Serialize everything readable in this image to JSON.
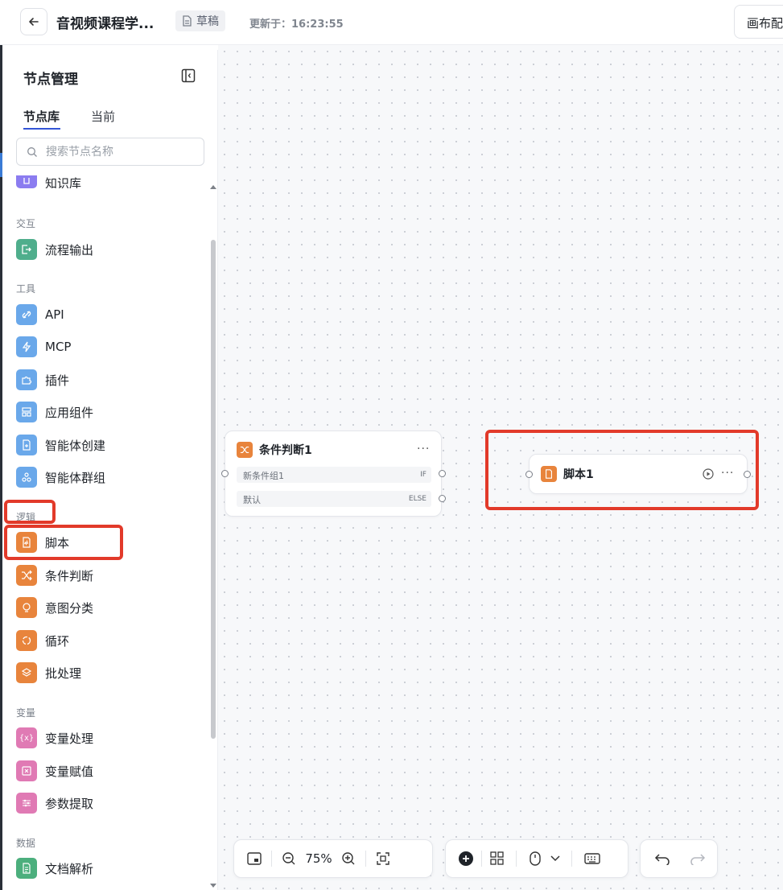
{
  "header": {
    "title": "音视频课程学...",
    "status": "草稿",
    "updated": "更新于：16:23:55",
    "canvas_config_label": "画布配"
  },
  "sidebar": {
    "title": "节点管理",
    "tabs": [
      {
        "label": "节点库"
      },
      {
        "label": "当前"
      }
    ],
    "search_placeholder": "搜索节点名称",
    "partial_item": "知识库",
    "groups": {
      "interaction": "交互",
      "tools": "工具",
      "logic": "逻辑",
      "variables": "变量",
      "data": "数据"
    },
    "items": {
      "flow_output": "流程输出",
      "api": "API",
      "mcp": "MCP",
      "plugin": "插件",
      "app_component": "应用组件",
      "agent_create": "智能体创建",
      "agent_group": "智能体群组",
      "script": "脚本",
      "condition": "条件判断",
      "intent": "意图分类",
      "loop": "循环",
      "batch": "批处理",
      "var_process": "变量处理",
      "var_assign": "变量赋值",
      "param_extract": "参数提取",
      "doc_parse": "文档解析"
    }
  },
  "canvas": {
    "condition_node": {
      "title": "条件判断1",
      "rows": [
        {
          "label": "新条件组1",
          "tag": "IF"
        },
        {
          "label": "默认",
          "tag": "ELSE"
        }
      ]
    },
    "script_node": {
      "title": "脚本1"
    }
  },
  "toolbar": {
    "zoom": "75%"
  },
  "colors": {
    "highlight": "#e23a2a",
    "logic_orange": "#e8843c",
    "tool_blue": "#6aa8ea",
    "interaction_green": "#4fae8c",
    "variable_pink": "#e07ab4",
    "knowledge_purple": "#8b7cf0",
    "data_green": "#4caf7d"
  }
}
